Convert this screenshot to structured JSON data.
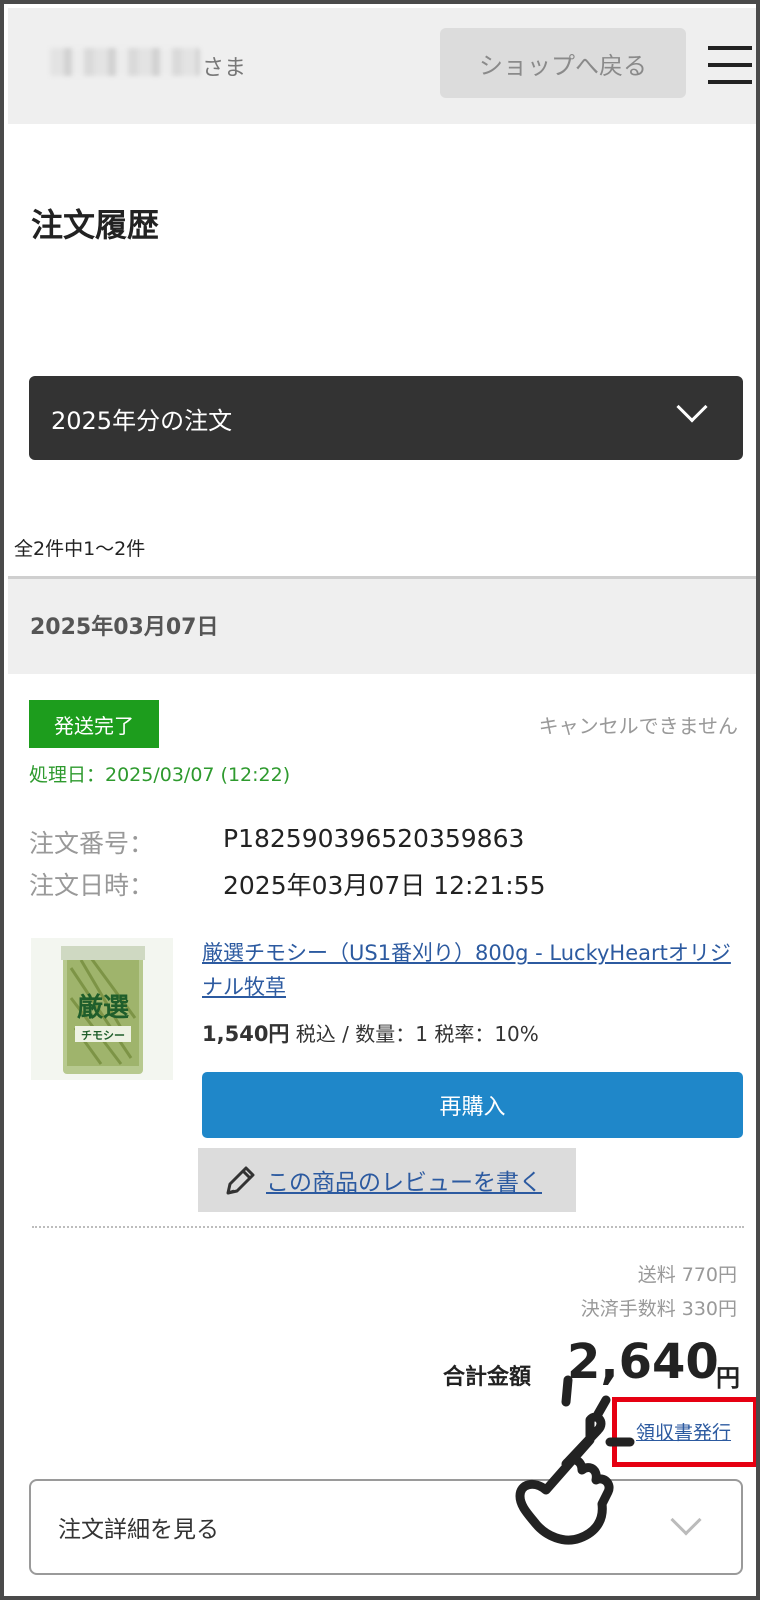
{
  "header": {
    "user_suffix": "さま",
    "back_button": "ショップへ戻る"
  },
  "page": {
    "title": "注文履歴",
    "year_select": "2025年分の注文",
    "result_count": "全2件中1～2件"
  },
  "order": {
    "date": "2025年03月07日",
    "status": "発送完了",
    "status_color": "#1d9d1d",
    "cancel_note": "キャンセルできません",
    "processed": "処理日：2025/03/07 (12:22)",
    "order_number_label": "注文番号：",
    "order_number": "P182590396520359863",
    "order_datetime_label": "注文日時：",
    "order_datetime": "2025年03月07日 12:21:55",
    "item": {
      "name": "厳選チモシー（US1番刈り）800g - LuckyHeartオリジナル牧草",
      "price": "1,540円",
      "price_detail": " 税込 / 数量：1 税率：10%",
      "rebuy_button": "再購入",
      "review_button": "この商品のレビューを書く",
      "image_label_main": "厳選",
      "image_label_sub": "チモシー"
    },
    "shipping_fee": "送料 770円",
    "payment_fee": "決済手数料 330円",
    "total_label": "合計金額",
    "total_value": "2,640",
    "total_unit": "円",
    "receipt_link": "領収書発行",
    "detail_toggle": "注文詳細を見る"
  },
  "colors": {
    "accent_blue": "#1f87c9",
    "link": "#2c5aa0",
    "highlight": "#e60012"
  }
}
